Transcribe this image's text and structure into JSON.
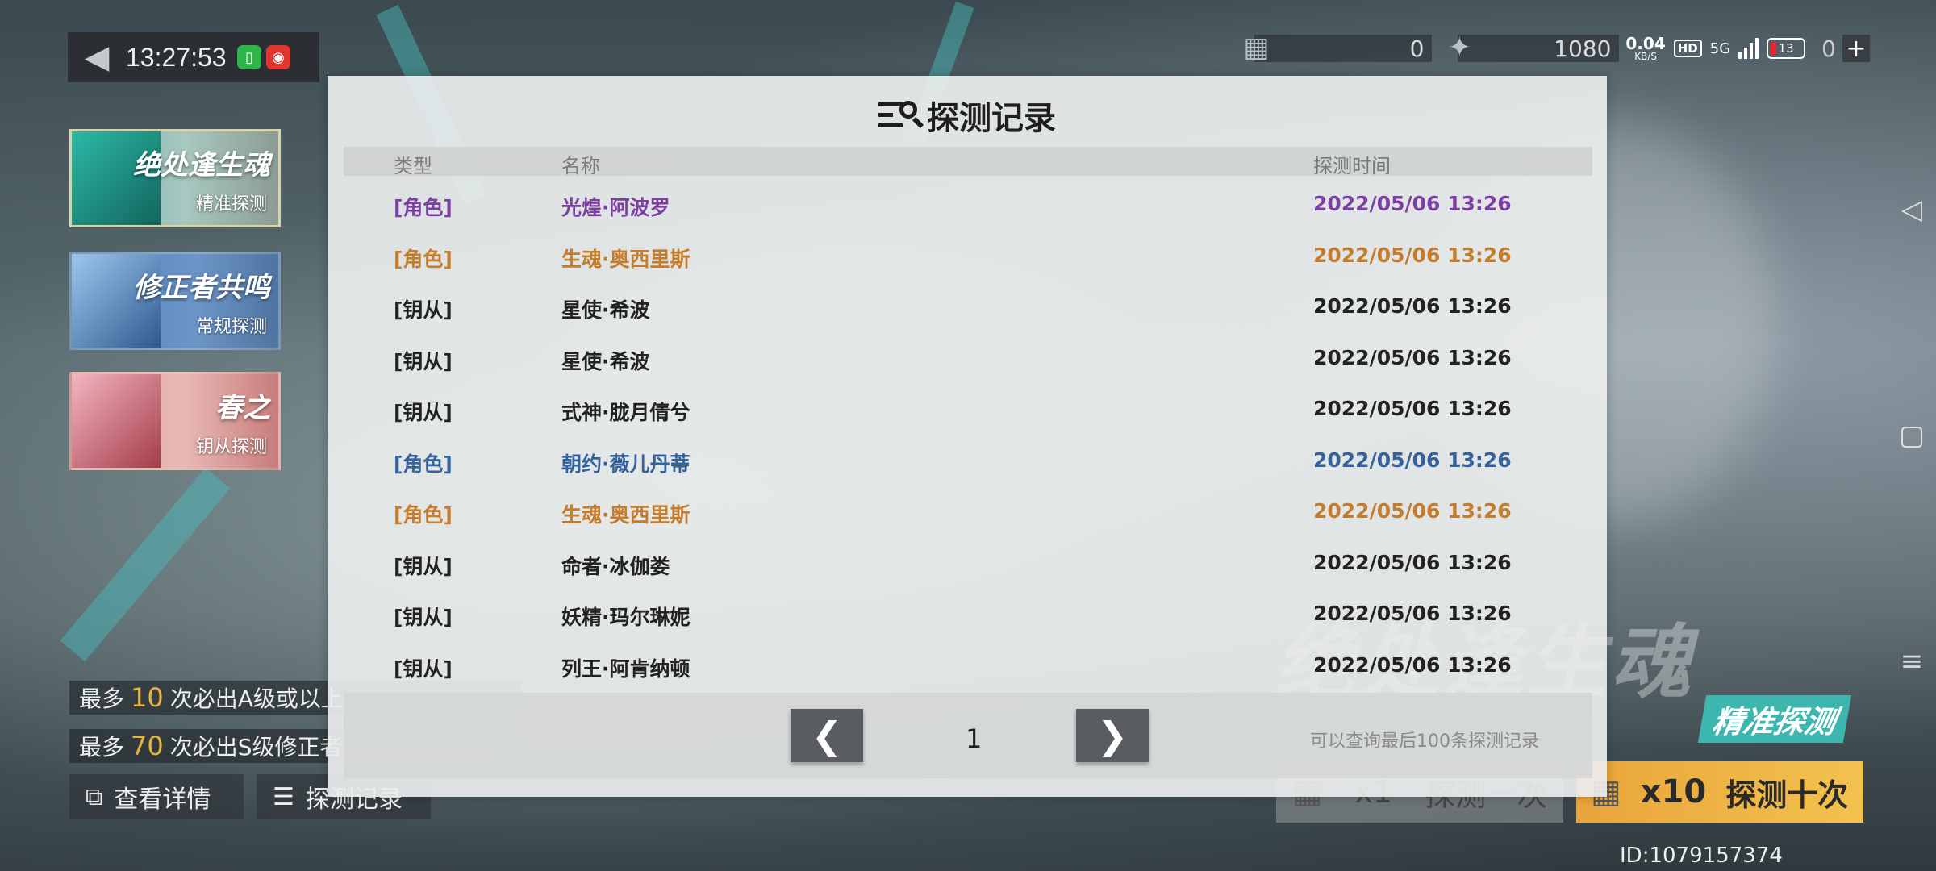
{
  "status_bar": {
    "time": "13:27:53",
    "currency_1": "0",
    "currency_2": "1080",
    "net_speed": "0.04",
    "net_unit": "KB/S",
    "hd": "HD",
    "network": "5G",
    "battery": "13",
    "plus_count": "0"
  },
  "banners": [
    {
      "title": "绝处逢生魂",
      "subtitle": "精准探测"
    },
    {
      "title": "修正者共鸣",
      "subtitle": "常规探测"
    },
    {
      "title": "春之",
      "subtitle": "钥从探测"
    }
  ],
  "guarantees": {
    "line1_prefix": "最多",
    "line1_num": "10",
    "line1_suffix": "次必出A级或以上",
    "line2_prefix": "最多",
    "line2_num": "70",
    "line2_suffix": "次必出S级修正者"
  },
  "bottom_buttons": {
    "details": "查看详情",
    "records": "探测记录"
  },
  "right_panel": {
    "big_title": "绝处逢生魂",
    "tag": "精准探测",
    "pull_one_count": "x1",
    "pull_one_label": "探测一次",
    "pull_ten_count": "x10",
    "pull_ten_label": "探测十次",
    "user_id": "ID:1079157374"
  },
  "modal": {
    "title": "探测记录",
    "headers": {
      "type": "类型",
      "name": "名称",
      "time": "探测时间"
    },
    "rows": [
      {
        "type": "[角色]",
        "name": "光煌·阿波罗",
        "time": "2022/05/06 13:26",
        "color": "#7a3fa0"
      },
      {
        "type": "[角色]",
        "name": "生魂·奥西里斯",
        "time": "2022/05/06 13:26",
        "color": "#c47d2c"
      },
      {
        "type": "[钥从]",
        "name": "星使·希波",
        "time": "2022/05/06 13:26",
        "color": "#222222"
      },
      {
        "type": "[钥从]",
        "name": "星使·希波",
        "time": "2022/05/06 13:26",
        "color": "#222222"
      },
      {
        "type": "[钥从]",
        "name": "式神·胧月倩兮",
        "time": "2022/05/06 13:26",
        "color": "#222222"
      },
      {
        "type": "[角色]",
        "name": "朝约·薇儿丹蒂",
        "time": "2022/05/06 13:26",
        "color": "#35629a"
      },
      {
        "type": "[角色]",
        "name": "生魂·奥西里斯",
        "time": "2022/05/06 13:26",
        "color": "#c47d2c"
      },
      {
        "type": "[钥从]",
        "name": "命者·冰伽娄",
        "time": "2022/05/06 13:26",
        "color": "#222222"
      },
      {
        "type": "[钥从]",
        "name": "妖精·玛尔琳妮",
        "time": "2022/05/06 13:26",
        "color": "#222222"
      },
      {
        "type": "[钥从]",
        "name": "列王·阿肯纳顿",
        "time": "2022/05/06 13:26",
        "color": "#222222"
      }
    ],
    "page": "1",
    "prev_glyph": "❮",
    "next_glyph": "❯",
    "note": "可以查询最后100条探测记录"
  }
}
